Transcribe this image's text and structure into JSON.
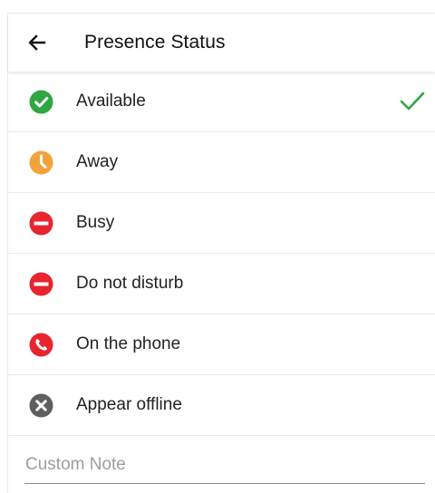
{
  "header": {
    "title": "Presence Status",
    "back_icon": "arrow-left-icon"
  },
  "statuses": [
    {
      "label": "Available",
      "icon": "check-circle-icon",
      "color": "#2ea642",
      "selected": true
    },
    {
      "label": "Away",
      "icon": "clock-icon",
      "color": "#f4a23a",
      "selected": false
    },
    {
      "label": "Busy",
      "icon": "minus-circle-icon",
      "color": "#e8242f",
      "selected": false
    },
    {
      "label": "Do not disturb",
      "icon": "minus-circle-icon",
      "color": "#e8242f",
      "selected": false
    },
    {
      "label": "On the phone",
      "icon": "phone-icon",
      "color": "#e8242f",
      "selected": false
    },
    {
      "label": "Appear offline",
      "icon": "x-circle-icon",
      "color": "#5f5f5f",
      "selected": false
    }
  ],
  "selected_check_color": "#2ea642",
  "custom_note": {
    "placeholder": "Custom Note",
    "value": ""
  }
}
